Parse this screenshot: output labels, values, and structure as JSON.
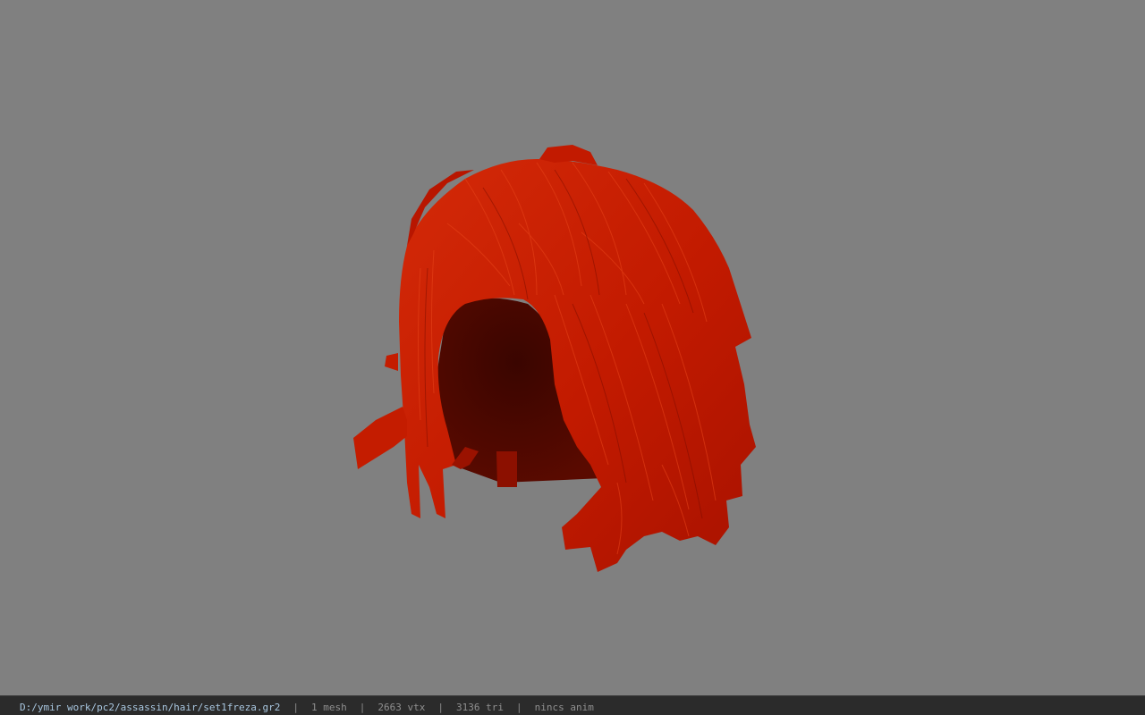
{
  "viewer": {
    "background_color": "#808080",
    "model_color": "#c21a00",
    "model_shadow_color": "#4a0800"
  },
  "statusbar": {
    "file_path": "D:/ymir work/pc2/assassin/hair/set1freza.gr2",
    "separator": "|",
    "mesh_count": "1 mesh",
    "vertex_count": "2663 vtx",
    "triangle_count": "3136 tri",
    "anim_status": "nincs anim"
  }
}
